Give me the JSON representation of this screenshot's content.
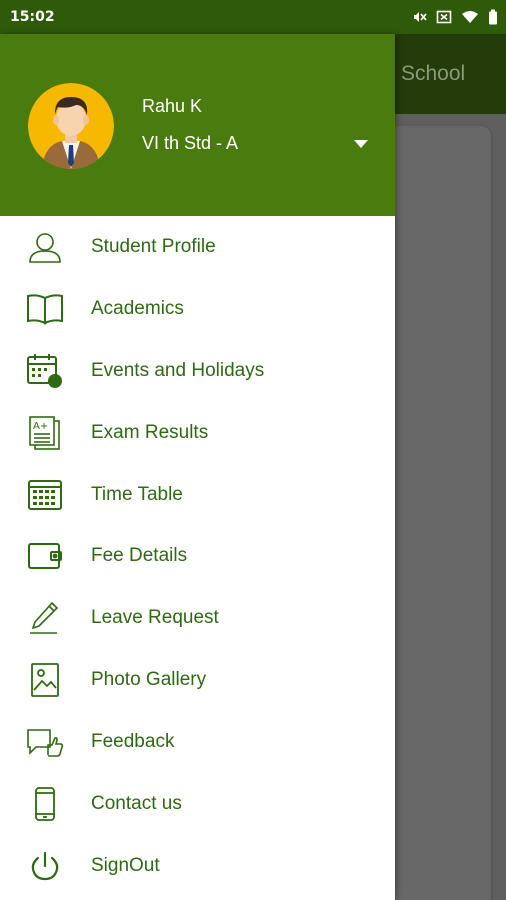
{
  "status_bar": {
    "time": "15:02",
    "icons": [
      "mute-icon",
      "close-box-icon",
      "wifi-icon",
      "battery-icon"
    ]
  },
  "background_app": {
    "title": "School"
  },
  "drawer": {
    "header": {
      "user_name": "Rahu K",
      "class_section": "VI th Std - A",
      "avatar_icon": "student-avatar-icon",
      "header_color": "#4a7b0e"
    },
    "menu": [
      {
        "label": "Student Profile",
        "icon": "user-icon"
      },
      {
        "label": "Academics",
        "icon": "book-icon"
      },
      {
        "label": "Events and Holidays",
        "icon": "calendar-icon"
      },
      {
        "label": "Exam Results",
        "icon": "exam-results-icon"
      },
      {
        "label": "Time Table",
        "icon": "timetable-icon"
      },
      {
        "label": "Fee Details",
        "icon": "wallet-icon"
      },
      {
        "label": "Leave Request",
        "icon": "pencil-icon"
      },
      {
        "label": "Photo Gallery",
        "icon": "photo-icon"
      },
      {
        "label": "Feedback",
        "icon": "feedback-icon"
      },
      {
        "label": "Contact us",
        "icon": "phone-icon"
      },
      {
        "label": "SignOut",
        "icon": "power-icon"
      }
    ],
    "accent_color": "#2e6a12"
  }
}
